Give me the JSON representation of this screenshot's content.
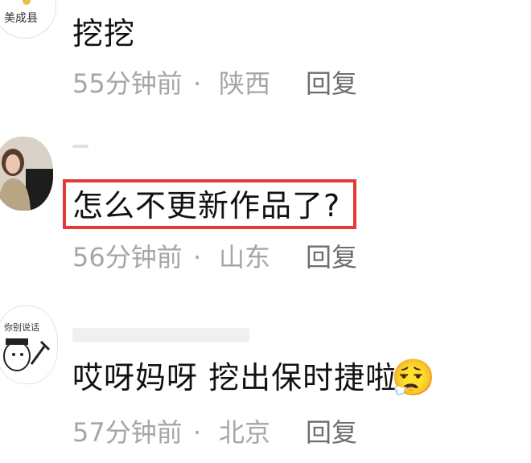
{
  "comments": [
    {
      "text": "挖挖",
      "time": "55分钟前",
      "dot": "·",
      "location": "陕西",
      "reply_label": "回复",
      "avatar_text": "美成县"
    },
    {
      "text": "怎么不更新作品了?",
      "time": "56分钟前",
      "dot": "·",
      "location": "山东",
      "reply_label": "回复",
      "highlight_color": "#e23a35"
    },
    {
      "text": "哎呀妈呀 挖出保时捷啦",
      "emoji": "😮‍💨",
      "time": "57分钟前",
      "dot": "·",
      "location": "北京",
      "reply_label": "回复",
      "avatar_text": "你别说话"
    }
  ]
}
